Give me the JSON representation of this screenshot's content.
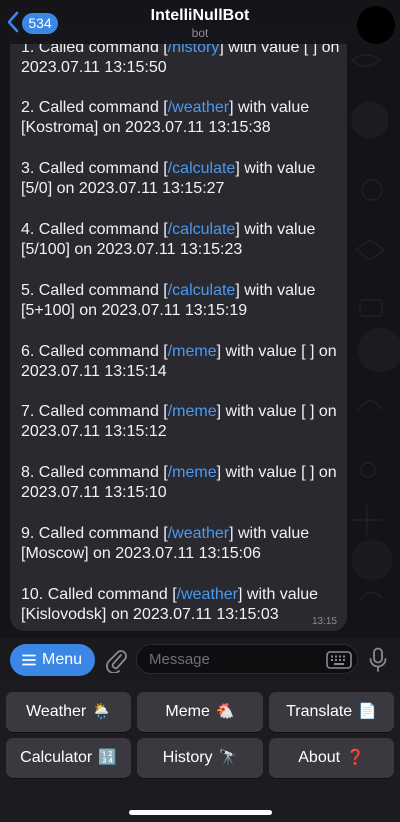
{
  "header": {
    "back_count": "534",
    "title": "IntelliNullBot",
    "subtitle": "bot"
  },
  "message": {
    "entries": [
      {
        "line1_pre": "1. Called command [",
        "cmd": "/history",
        "line1_post": "] with value [ ] on",
        "line2": "2023.07.11 13:15:50"
      },
      {
        "line1_pre": "2. Called command [",
        "cmd": "/weather",
        "line1_post": "] with value",
        "line2": "[Kostroma] on 2023.07.11 13:15:38"
      },
      {
        "line1_pre": "3. Called command [",
        "cmd": "/calculate",
        "line1_post": "] with value",
        "line2": "[5/0] on 2023.07.11 13:15:27"
      },
      {
        "line1_pre": "4. Called command [",
        "cmd": "/calculate",
        "line1_post": "] with value",
        "line2": "[5/100] on 2023.07.11 13:15:23"
      },
      {
        "line1_pre": "5. Called command [",
        "cmd": "/calculate",
        "line1_post": "] with value",
        "line2": "[5+100] on 2023.07.11 13:15:19"
      },
      {
        "line1_pre": "6. Called command [",
        "cmd": "/meme",
        "line1_post": "] with value [ ] on",
        "line2": "2023.07.11 13:15:14"
      },
      {
        "line1_pre": "7. Called command [",
        "cmd": "/meme",
        "line1_post": "] with value [ ] on",
        "line2": "2023.07.11 13:15:12"
      },
      {
        "line1_pre": "8. Called command [",
        "cmd": "/meme",
        "line1_post": "] with value [ ] on",
        "line2": "2023.07.11 13:15:10"
      },
      {
        "line1_pre": "9. Called command [",
        "cmd": "/weather",
        "line1_post": "] with value",
        "line2": "[Moscow] on 2023.07.11 13:15:06"
      },
      {
        "line1_pre": "10. Called command [",
        "cmd": "/weather",
        "line1_post": "] with value",
        "line2": "[Kislovodsk] on 2023.07.11 13:15:03"
      }
    ],
    "time": "13:15"
  },
  "inputbar": {
    "menu_label": "Menu",
    "placeholder": "Message"
  },
  "keyboard": {
    "rows": [
      [
        {
          "label": "Weather",
          "emoji": "🌦️"
        },
        {
          "label": "Meme",
          "emoji": "🐔"
        },
        {
          "label": "Translate",
          "emoji": "📄"
        }
      ],
      [
        {
          "label": "Calculator",
          "emoji": "🔢"
        },
        {
          "label": "History",
          "emoji": "🔭"
        },
        {
          "label": "About",
          "emoji": "❓"
        }
      ]
    ]
  },
  "colors": {
    "accent": "#3a87e6",
    "link": "#4a9af0",
    "bubble": "#2a2930",
    "key": "#3a3940"
  },
  "icons": [
    "chevron-left-icon",
    "hamburger-icon",
    "paperclip-icon",
    "keyboard-icon",
    "microphone-icon"
  ]
}
